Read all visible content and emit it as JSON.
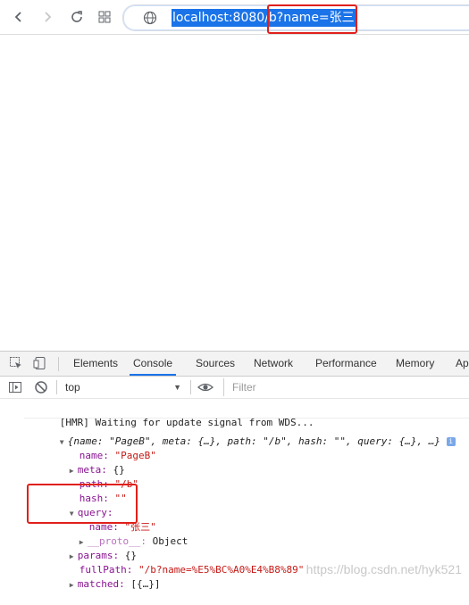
{
  "browser": {
    "url_text": "localhost:8080/b?name=张三",
    "icons": {
      "back": "back-arrow-icon",
      "forward": "forward-arrow-icon",
      "reload": "reload-icon",
      "apps": "apps-grid-icon",
      "site": "globe-icon"
    }
  },
  "devtools": {
    "tabs": [
      "Elements",
      "Console",
      "Sources",
      "Network",
      "Performance",
      "Memory",
      "Ap"
    ],
    "active_tab": "Console",
    "context_select": "top",
    "filter_placeholder": "Filter"
  },
  "console": {
    "hmr_message": "[HMR] Waiting for update signal from WDS...",
    "object_summary": "{name: \"PageB\", meta: {…}, path: \"/b\", hash: \"\", query: {…}, …}",
    "info_badge": "i",
    "props": {
      "name_key": "name:",
      "name_val": "\"PageB\"",
      "meta_key": "meta:",
      "meta_val": "{}",
      "path_key": "path:",
      "path_val": "\"/b\"",
      "hash_key": "hash:",
      "hash_val": "\"\"",
      "query_key": "query:",
      "query_name_key": "name:",
      "query_name_val": "\"张三\"",
      "proto_key": "__proto__:",
      "proto_val": "Object",
      "params_key": "params:",
      "params_val": "{}",
      "fullpath_key": "fullPath:",
      "fullpath_val": "\"/b?name=%E5%BC%A0%E4%B8%89\"",
      "matched_key": "matched:",
      "matched_val": "[{…}]"
    }
  },
  "watermark": "https://blog.csdn.net/hyk521",
  "colors": {
    "url_highlight": "#1a73e8",
    "annotation_red": "#e0201b",
    "key_purple": "#881391",
    "string_red": "#c41a16",
    "active_tab_underline": "#1a73e8"
  }
}
